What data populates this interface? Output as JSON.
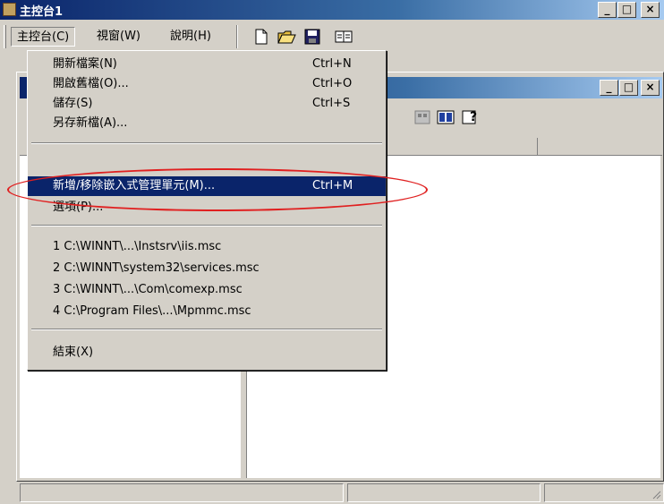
{
  "window": {
    "title": "主控台1",
    "min": "_",
    "max": "□",
    "close": "×"
  },
  "menubar": {
    "items": [
      "主控台(C)",
      "視窗(W)",
      "說明(H)"
    ]
  },
  "child_window": {
    "min": "_",
    "max": "□",
    "close": "×"
  },
  "dropdown": {
    "group1": [
      {
        "label": "開新檔案(N)",
        "shortcut": "Ctrl+N"
      },
      {
        "label": "開啟舊檔(O)...",
        "shortcut": "Ctrl+O"
      },
      {
        "label": "儲存(S)",
        "shortcut": "Ctrl+S"
      },
      {
        "label": "另存新檔(A)...",
        "shortcut": ""
      }
    ],
    "highlighted": {
      "label": "新增/移除嵌入式管理單元(M)...",
      "shortcut": "Ctrl+M"
    },
    "options": {
      "label": "選項(P)..."
    },
    "recent": [
      "1 C:\\WINNT\\...\\Instsrv\\iis.msc",
      "2 C:\\WINNT\\system32\\services.msc",
      "3 C:\\WINNT\\...\\Com\\comexp.msc",
      "4 C:\\Program Files\\...\\Mpmmc.msc"
    ],
    "exit": {
      "label": "結束(X)"
    }
  },
  "colors": {
    "titlebar": "#0a246a",
    "highlight": "#0a246a",
    "annotation": "#e02020"
  }
}
